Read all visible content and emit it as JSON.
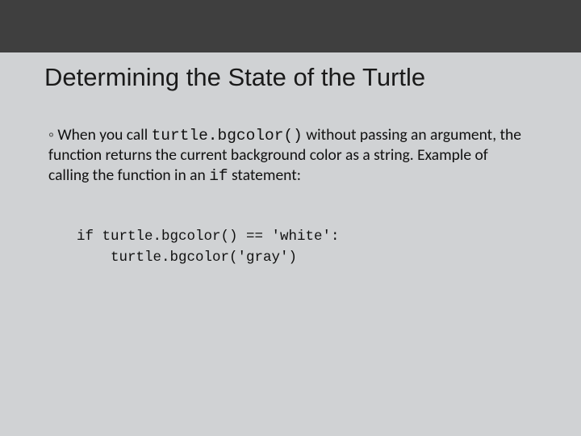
{
  "slide": {
    "title": "Determining the State of the Turtle",
    "bullet": {
      "mark": "◦ ",
      "t1": "When you call ",
      "code1": "turtle.bgcolor()",
      "t2": " without passing an argument, the function returns the current background color as a string. Example of calling the function in an ",
      "code2": "if",
      "t3": " statement:"
    },
    "code": {
      "line1": "if turtle.bgcolor() == 'white':",
      "line2": "    turtle.bgcolor('gray')"
    }
  }
}
